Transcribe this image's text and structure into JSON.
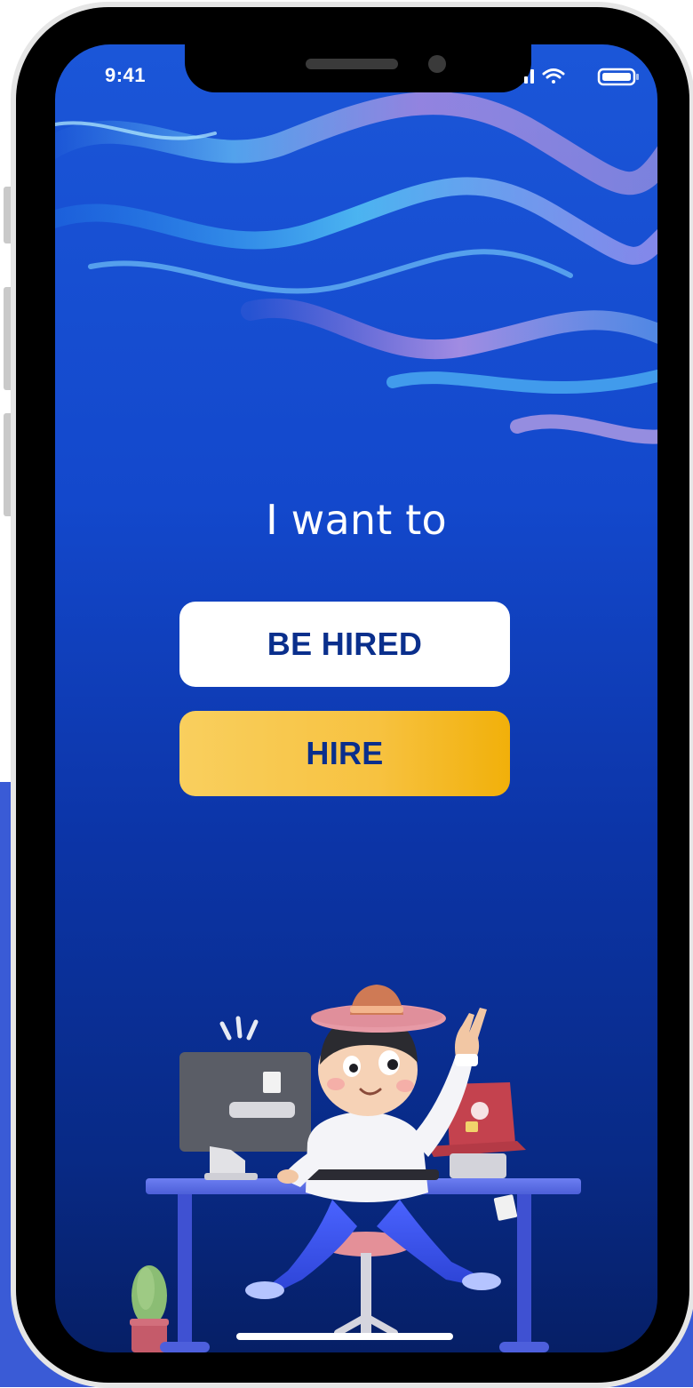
{
  "status_bar": {
    "time": "9:41",
    "icons": [
      "cellular-signal-icon",
      "wifi-icon",
      "battery-icon"
    ]
  },
  "onboarding": {
    "headline": "I want to",
    "options": [
      {
        "id": "be-hired",
        "label": "BE HIRED"
      },
      {
        "id": "hire",
        "label": "HIRE"
      }
    ]
  },
  "colors": {
    "background_top": "#1b56d8",
    "background_bottom": "#061f66",
    "primary_button_bg": "#ffffff",
    "secondary_button_bg": "#f7c240",
    "button_text": "#0a2f8c",
    "backdrop": "#3a5bd6"
  }
}
